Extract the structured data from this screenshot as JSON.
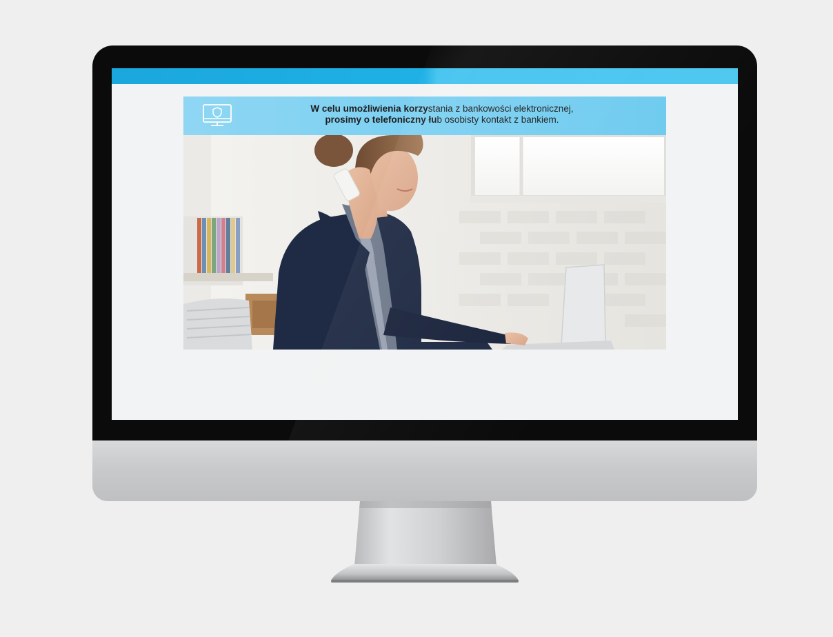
{
  "banner": {
    "icon": "monitor-shield-icon",
    "line1_bold": "W celu umożliwienia korzy",
    "line1_rest": "stania  z bankowości elektronicznej,",
    "line2_bold": "prosimy o telefoniczny łu",
    "line2_rest": "b osobisty  kontakt z bankiem."
  },
  "photo": {
    "subject": "woman-on-phone-at-laptop"
  },
  "colors": {
    "top_bar": "#1aa7de",
    "banner": "#7fd1f2",
    "screen_bg": "#f1f3f4",
    "bezel": "#0b0b0b",
    "chin": "#c9cacc",
    "page_bg": "#efefef"
  }
}
